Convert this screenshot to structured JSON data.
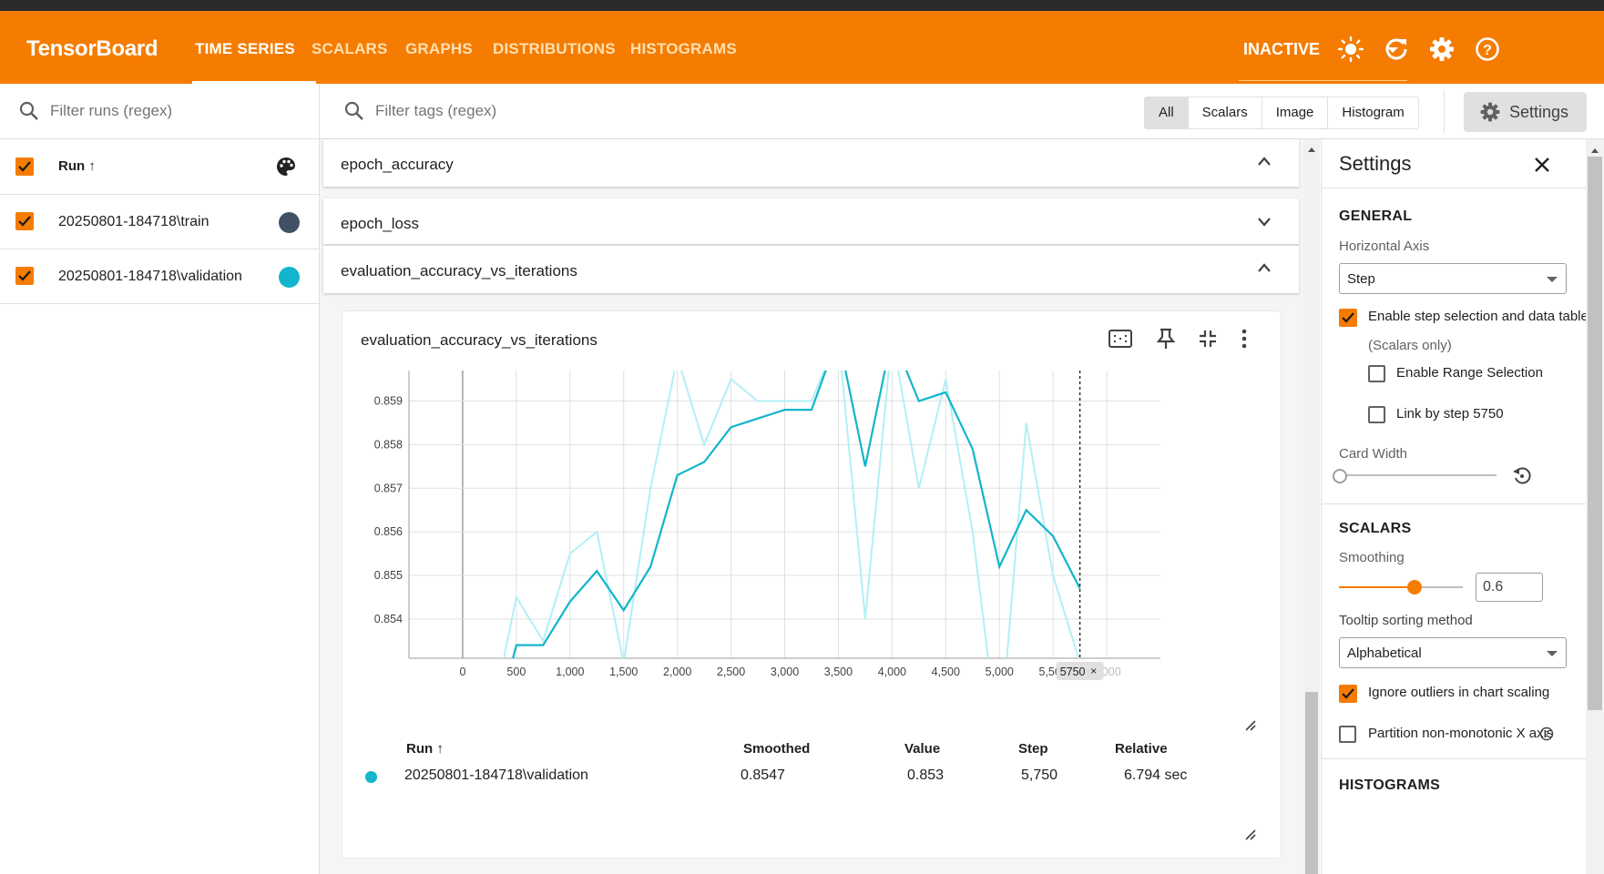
{
  "app": {
    "title": "TensorBoard"
  },
  "nav": {
    "tabs": [
      "TIME SERIES",
      "SCALARS",
      "GRAPHS",
      "DISTRIBUTIONS",
      "HISTOGRAMS"
    ],
    "active_tab": "TIME SERIES",
    "status": "INACTIVE"
  },
  "colors": {
    "brand": "#f57c00",
    "train": "#425066",
    "validation": "#12b5cb",
    "validation_raw": "#b3eff5"
  },
  "runs_panel": {
    "filter_placeholder": "Filter runs (regex)",
    "header": "Run ↑",
    "runs": [
      {
        "label": "20250801-184718\\train",
        "checked": true
      },
      {
        "label": "20250801-184718\\validation",
        "checked": true
      }
    ]
  },
  "main": {
    "filter_placeholder": "Filter tags (regex)",
    "type_filters": [
      "All",
      "Scalars",
      "Image",
      "Histogram"
    ],
    "selected_filter": "All",
    "settings_button": "Settings",
    "groups": [
      {
        "title": "epoch_accuracy",
        "expanded": true
      },
      {
        "title": "epoch_loss",
        "expanded": false
      },
      {
        "title": "evaluation_accuracy_vs_iterations",
        "expanded": true
      }
    ],
    "card": {
      "title": "evaluation_accuracy_vs_iterations",
      "step_marker_label": "5750",
      "table": {
        "headers": [
          "Run ↑",
          "Smoothed",
          "Value",
          "Step",
          "Relative"
        ],
        "rows": [
          {
            "run": "20250801-184718\\validation",
            "smoothed": "0.8547",
            "value": "0.853",
            "step": "5,750",
            "relative": "6.794 sec"
          }
        ]
      }
    }
  },
  "chart_data": {
    "type": "line",
    "title": "evaluation_accuracy_vs_iterations",
    "xlabel": "",
    "ylabel": "",
    "x_ticks": [
      "0",
      "500",
      "1,000",
      "1,500",
      "2,000",
      "2,500",
      "3,000",
      "3,500",
      "4,000",
      "4,500",
      "5,000",
      "5,500",
      "6,000"
    ],
    "y_ticks": [
      "0.854",
      "0.855",
      "0.856",
      "0.857",
      "0.858",
      "0.859"
    ],
    "xlim": [
      -500,
      6500
    ],
    "ylim": [
      0.8531,
      0.8597
    ],
    "grid": true,
    "series": [
      {
        "name": "20250801-184718\\validation",
        "kind": "raw",
        "x": [
          250,
          500,
          750,
          1000,
          1250,
          1500,
          1750,
          2000,
          2250,
          2500,
          2750,
          3000,
          3250,
          3500,
          3750,
          4000,
          4250,
          4500,
          4750,
          5000,
          5250,
          5500,
          5750
        ],
        "y": [
          0.8515,
          0.8545,
          0.8535,
          0.8555,
          0.856,
          0.853,
          0.857,
          0.86,
          0.858,
          0.8595,
          0.859,
          0.859,
          0.859,
          0.8605,
          0.854,
          0.8605,
          0.857,
          0.8595,
          0.856,
          0.851,
          0.8585,
          0.855,
          0.853
        ]
      },
      {
        "name": "20250801-184718\\validation",
        "kind": "smoothed",
        "x": [
          250,
          500,
          750,
          1000,
          1250,
          1500,
          1750,
          2000,
          2250,
          2500,
          2750,
          3000,
          3250,
          3500,
          3750,
          4000,
          4250,
          4500,
          4750,
          5000,
          5250,
          5500,
          5750
        ],
        "y": [
          0.851,
          0.8534,
          0.8534,
          0.8544,
          0.8551,
          0.8542,
          0.8552,
          0.8573,
          0.8576,
          0.8584,
          0.8586,
          0.8588,
          0.8588,
          0.8605,
          0.8575,
          0.8605,
          0.859,
          0.8592,
          0.8579,
          0.8552,
          0.8565,
          0.8559,
          0.8547
        ]
      }
    ]
  },
  "settings_panel": {
    "title": "Settings",
    "general": {
      "heading": "GENERAL",
      "horizontal_axis_label": "Horizontal Axis",
      "horizontal_axis_value": "Step",
      "step_selection_label": "Enable step selection and data table",
      "scalars_only": "(Scalars only)",
      "range_selection_label": "Enable Range Selection",
      "link_by_step_label": "Link by step 5750",
      "card_width_label": "Card Width",
      "card_width_value": 0
    },
    "scalars": {
      "heading": "SCALARS",
      "smoothing_label": "Smoothing",
      "smoothing_value": "0.6",
      "tooltip_sort_label": "Tooltip sorting method",
      "tooltip_sort_value": "Alphabetical",
      "ignore_outliers_label": "Ignore outliers in chart scaling",
      "partition_label": "Partition non-monotonic X axis"
    },
    "histograms": {
      "heading": "HISTOGRAMS"
    }
  }
}
